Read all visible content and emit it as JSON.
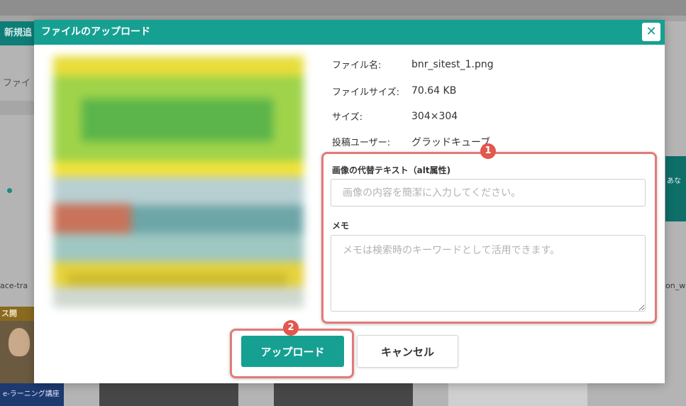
{
  "background": {
    "header_fragment": "新規追",
    "file_label_fragment": "ファイ",
    "filename_left": "ace-tra",
    "filename_right": "on_w",
    "ribbon_fragment": "ス開",
    "learning_label": "e-ラーニング講座",
    "ad_fragment": "あな"
  },
  "modal": {
    "title": "ファイルのアップロード",
    "close_glyph": "✕",
    "info": {
      "filename_label": "ファイル名:",
      "filename_value": "bnr_sitest_1.png",
      "filesize_label": "ファイルサイズ:",
      "filesize_value": "70.64 KB",
      "size_label": "サイズ:",
      "size_value": "304×304",
      "uploader_label": "投稿ユーザー:",
      "uploader_value": "グラッドキューブ"
    },
    "alt_text": {
      "label": "画像の代替テキスト（alt属性)",
      "value": "",
      "placeholder": "画像の内容を簡潔に入力してください。"
    },
    "memo": {
      "label": "メモ",
      "value": "",
      "placeholder": "メモは検索時のキーワードとして活用できます。"
    },
    "buttons": {
      "upload": "アップロード",
      "cancel": "キャンセル"
    }
  },
  "annotations": {
    "badge1": "1",
    "badge2": "2",
    "color": "#e27a78"
  },
  "colors": {
    "accent": "#16a091",
    "badge": "#e2574e"
  }
}
